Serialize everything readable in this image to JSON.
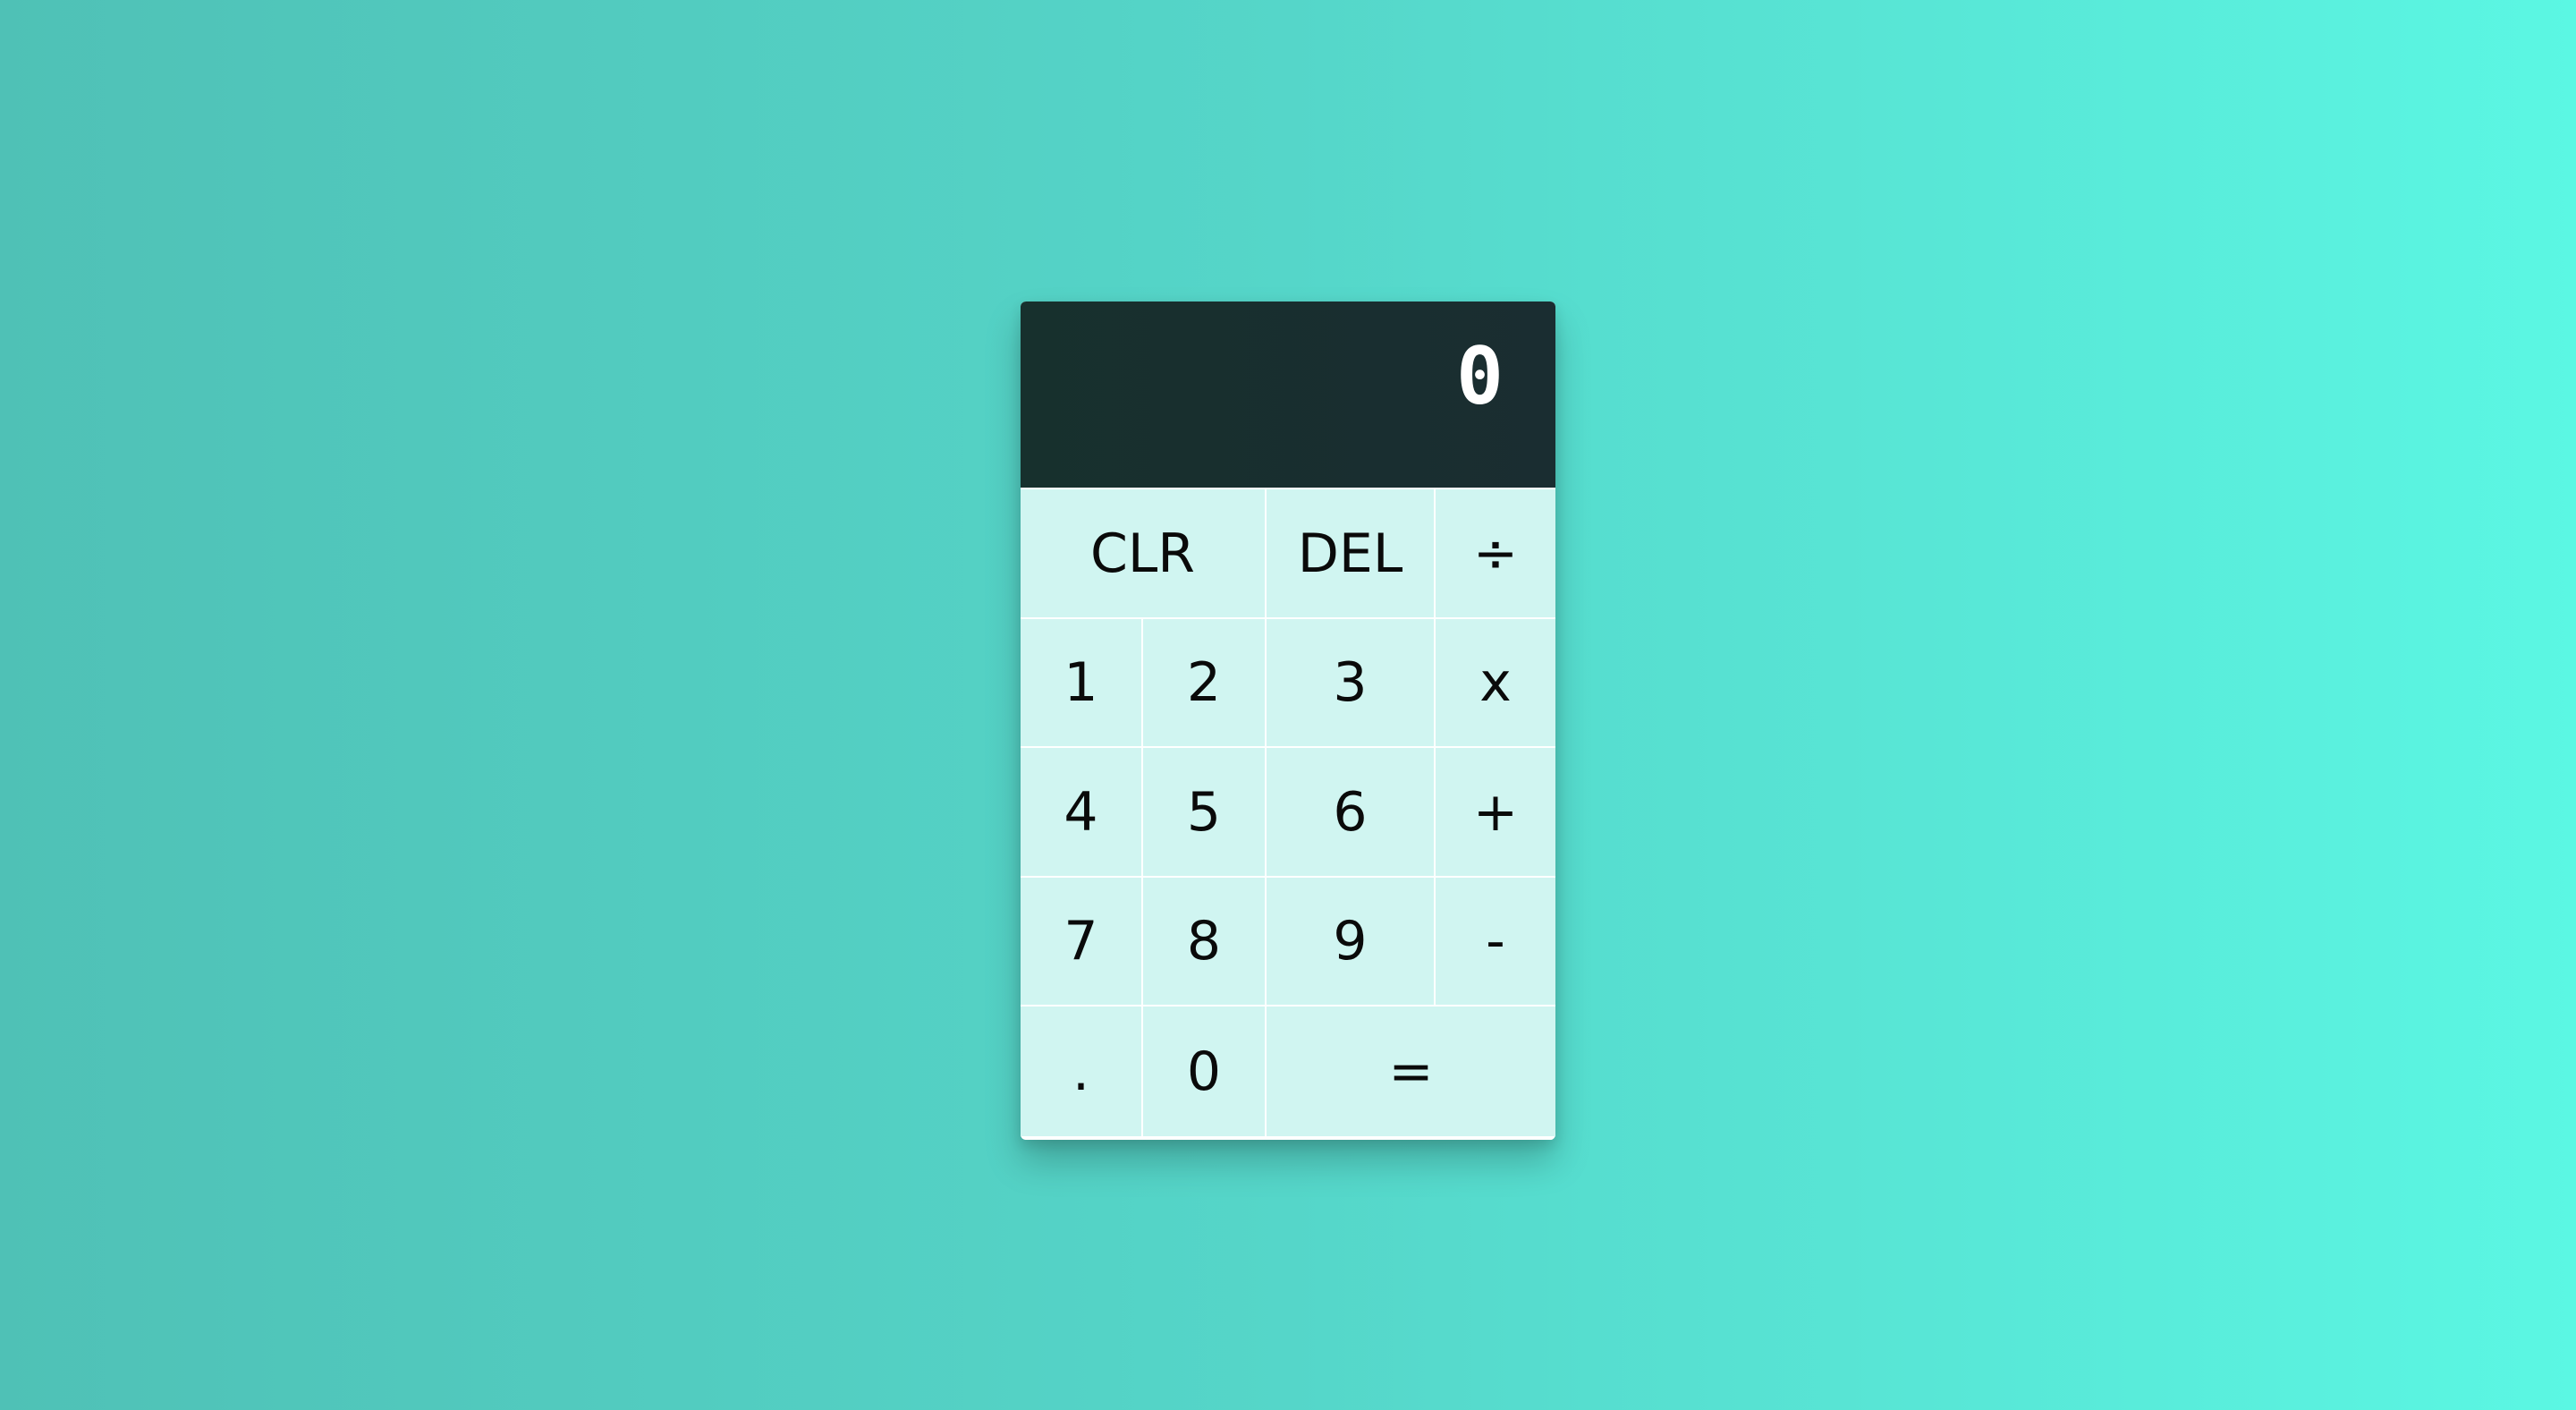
{
  "display": {
    "value": "0"
  },
  "keys": {
    "clr": "CLR",
    "del": "DEL",
    "divide": "÷",
    "one": "1",
    "two": "2",
    "three": "3",
    "multiply": "x",
    "four": "4",
    "five": "5",
    "six": "6",
    "plus": "+",
    "seven": "7",
    "eight": "8",
    "nine": "9",
    "minus": "-",
    "dot": ".",
    "zero": "0",
    "equals": "="
  },
  "colors": {
    "background_start": "#4fc1b6",
    "background_end": "#5bf7e3",
    "display_background": "#1a2d31",
    "key_background": "#d0f5f1",
    "key_text": "#0a0a0a",
    "display_text": "#ffffff"
  }
}
